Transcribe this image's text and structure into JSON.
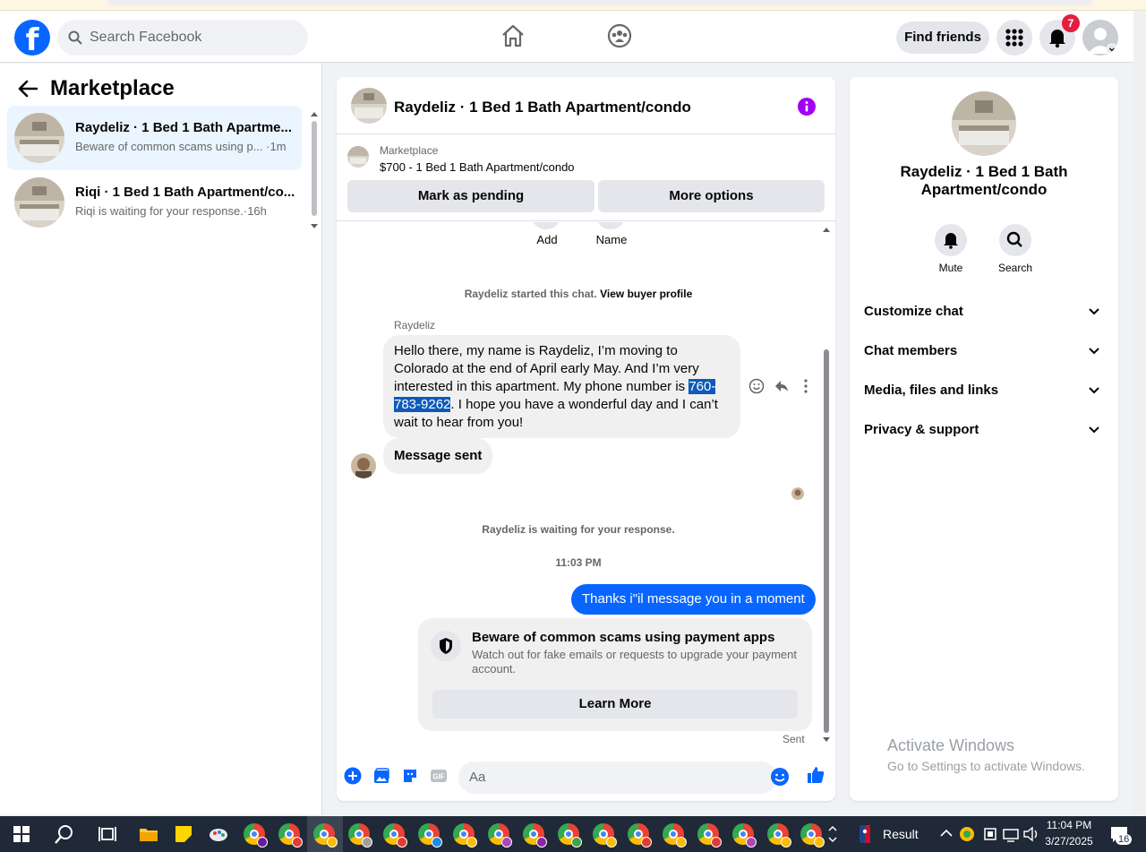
{
  "topbar": {
    "search_placeholder": "Search Facebook",
    "find_friends": "Find friends",
    "notification_count": "7"
  },
  "left": {
    "title": "Marketplace",
    "conversations": [
      {
        "title": "Raydeliz · 1 Bed 1 Bath Apartme...",
        "snippet": "Beware of common scams using p... ·1m",
        "active": true
      },
      {
        "title": "Riqi · 1 Bed 1 Bath Apartment/co...",
        "snippet": "Riqi is waiting for your response.·16h",
        "active": false
      }
    ]
  },
  "chat": {
    "header_title": "Raydeliz · 1 Bed 1 Bath Apartment/condo",
    "listing_source": "Marketplace",
    "listing_title": "$700 - 1 Bed 1 Bath Apartment/condo",
    "mark_pending": "Mark as pending",
    "more_options": "More options",
    "add_label": "Add",
    "name_label": "Name",
    "started_text": "Raydeliz started this chat.",
    "view_profile": "View buyer profile",
    "sender_name": "Raydeliz",
    "msg_part1": "Hello there, my name is Raydeliz, I’m moving to Colorado at the end of April early May. And I’m very interested in this apartment. My phone number is ",
    "msg_phone_a": "760-",
    "msg_phone_b": "783-9262",
    "msg_part2": ". I hope you have a wonderful day and I can’t wait to hear from you!",
    "msg_sent": "Message sent",
    "waiting_text": "Raydeliz is waiting for your response.",
    "timestamp": "11:03 PM",
    "outgoing": "Thanks i\"il message you in a moment",
    "scam_title": "Beware of common scams using payment apps",
    "scam_desc": "Watch out for fake emails or requests to upgrade your payment account.",
    "learn_more": "Learn More",
    "sent_label": "Sent",
    "input_placeholder": "Aa"
  },
  "right": {
    "name": "Raydeliz · 1 Bed 1 Bath Apartment/condo",
    "mute": "Mute",
    "search": "Search",
    "sections": [
      "Customize chat",
      "Chat members",
      "Media, files and links",
      "Privacy & support"
    ]
  },
  "watermark": {
    "line1": "Activate Windows",
    "line2": "Go to Settings to activate Windows."
  },
  "taskbar": {
    "result": "Result",
    "time": "11:04 PM",
    "date": "3/27/2025",
    "notif_count": "16"
  },
  "colors": {
    "brand": "#0866ff",
    "info": "#a100f2",
    "badge": "#e41e3f"
  }
}
